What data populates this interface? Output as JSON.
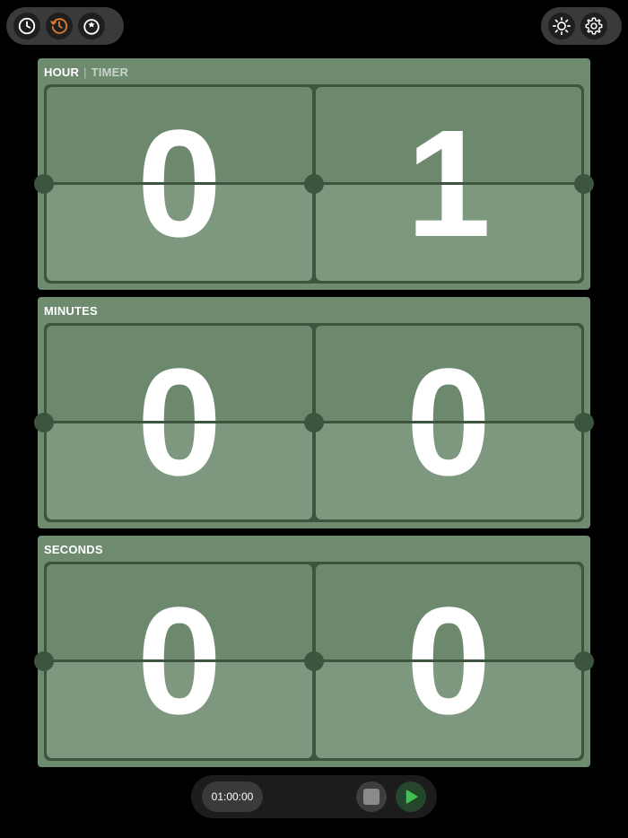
{
  "toolbar": {
    "mode_icons": [
      "clock-icon",
      "history-timer-icon",
      "star-timer-icon"
    ],
    "util_icons": [
      "brightness-icon",
      "gear-icon"
    ],
    "active_color": "#e07a2f"
  },
  "panels": {
    "hour": {
      "title": "HOUR",
      "separator": "|",
      "subtitle": "TIMER",
      "digits": [
        "0",
        "1"
      ]
    },
    "minutes": {
      "title": "MINUTES",
      "digits": [
        "0",
        "0"
      ]
    },
    "seconds": {
      "title": "SECONDS",
      "digits": [
        "0",
        "0"
      ]
    }
  },
  "controls": {
    "duration": "01:00:00",
    "play_color": "#3fc04f"
  }
}
